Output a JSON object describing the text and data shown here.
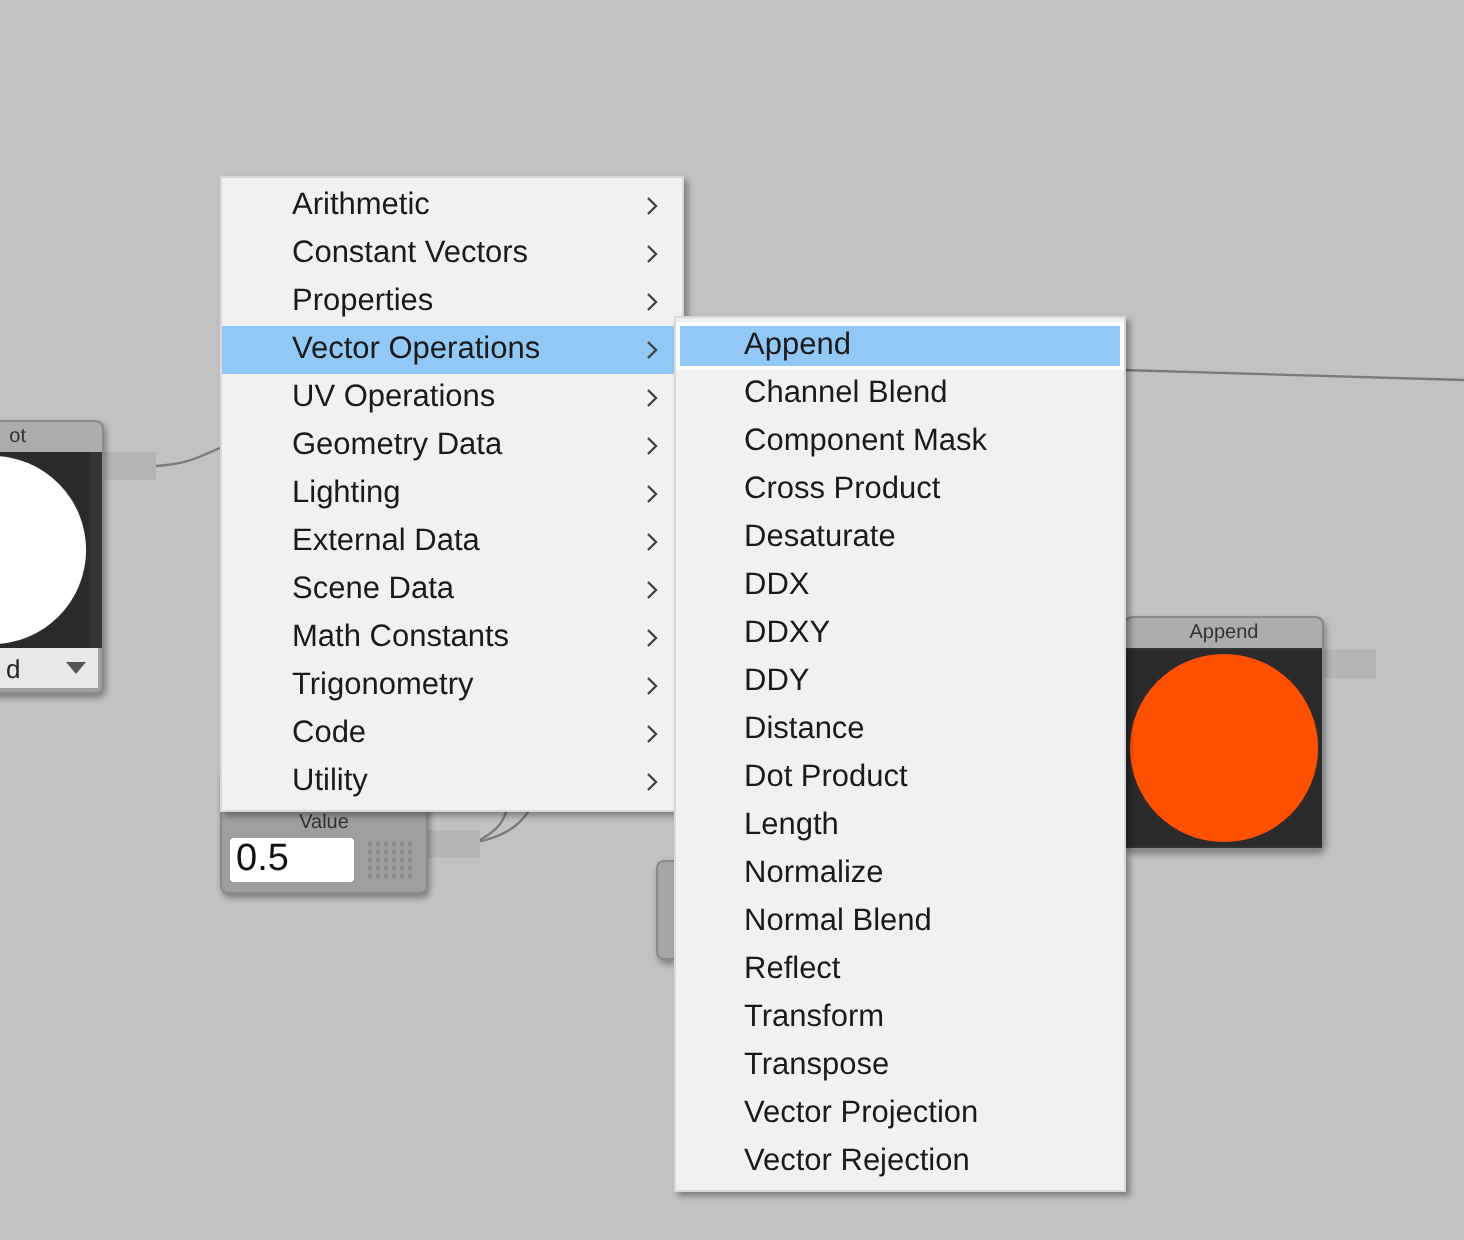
{
  "nodes": [
    {
      "kind": "preview_dropdown",
      "title": "ot",
      "color": "#ffffff",
      "dropdown_value": "d"
    },
    {
      "kind": "value",
      "title": "Value",
      "value": "0.5"
    },
    {
      "kind": "preview",
      "title": "Append",
      "color": "#ff5000"
    },
    {
      "kind": "collapsed"
    }
  ],
  "context_menu": {
    "items": [
      {
        "label": "Arithmetic",
        "selected": false
      },
      {
        "label": "Constant Vectors",
        "selected": false
      },
      {
        "label": "Properties",
        "selected": false
      },
      {
        "label": "Vector Operations",
        "selected": true
      },
      {
        "label": "UV Operations",
        "selected": false
      },
      {
        "label": "Geometry Data",
        "selected": false
      },
      {
        "label": "Lighting",
        "selected": false
      },
      {
        "label": "External Data",
        "selected": false
      },
      {
        "label": "Scene Data",
        "selected": false
      },
      {
        "label": "Math Constants",
        "selected": false
      },
      {
        "label": "Trigonometry",
        "selected": false
      },
      {
        "label": "Code",
        "selected": false
      },
      {
        "label": "Utility",
        "selected": false
      }
    ],
    "submenu": {
      "items": [
        {
          "label": "Append",
          "selected": true
        },
        {
          "label": "Channel Blend",
          "selected": false
        },
        {
          "label": "Component Mask",
          "selected": false
        },
        {
          "label": "Cross Product",
          "selected": false
        },
        {
          "label": "Desaturate",
          "selected": false
        },
        {
          "label": "DDX",
          "selected": false
        },
        {
          "label": "DDXY",
          "selected": false
        },
        {
          "label": "DDY",
          "selected": false
        },
        {
          "label": "Distance",
          "selected": false
        },
        {
          "label": "Dot Product",
          "selected": false
        },
        {
          "label": "Length",
          "selected": false
        },
        {
          "label": "Normalize",
          "selected": false
        },
        {
          "label": "Normal Blend",
          "selected": false
        },
        {
          "label": "Reflect",
          "selected": false
        },
        {
          "label": "Transform",
          "selected": false
        },
        {
          "label": "Transpose",
          "selected": false
        },
        {
          "label": "Vector Projection",
          "selected": false
        },
        {
          "label": "Vector Rejection",
          "selected": false
        }
      ]
    }
  }
}
